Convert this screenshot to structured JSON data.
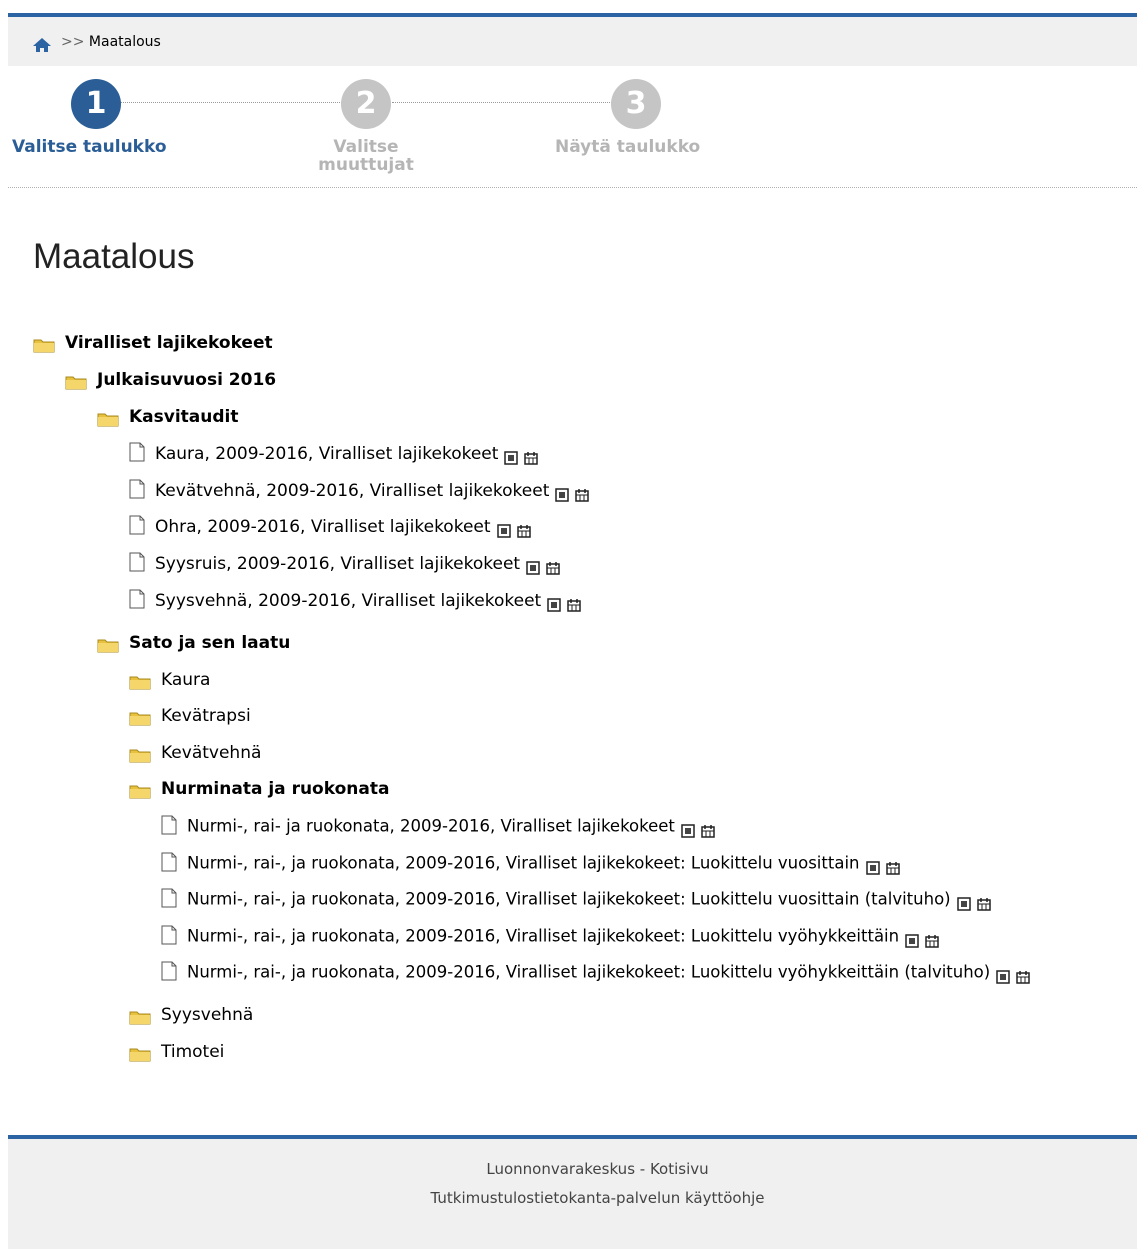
{
  "breadcrumb": {
    "separator": ">>",
    "current": "Maatalous"
  },
  "steps": [
    {
      "number": "1",
      "label": "Valitse taulukko"
    },
    {
      "number": "2",
      "label_line1": "Valitse",
      "label_line2": "muuttujat"
    },
    {
      "number": "3",
      "label": "Näytä taulukko"
    }
  ],
  "page_title": "Maatalous",
  "tree": {
    "l0": "Viralliset lajikekokeet",
    "l1": "Julkaisuvuosi 2016",
    "kasvitaudit": {
      "label": "Kasvitaudit",
      "files": [
        "Kaura, 2009-2016, Viralliset lajikekokeet",
        "Kevätvehnä, 2009-2016, Viralliset lajikekokeet",
        "Ohra, 2009-2016, Viralliset lajikekokeet",
        "Syysruis, 2009-2016, Viralliset lajikekokeet",
        "Syysvehnä, 2009-2016, Viralliset lajikekokeet"
      ]
    },
    "sato": {
      "label": "Sato ja sen laatu",
      "folders": [
        "Kaura",
        "Kevätrapsi",
        "Kevätvehnä"
      ],
      "nurminata": {
        "label": "Nurminata ja ruokonata",
        "files": [
          "Nurmi-, rai- ja ruokonata, 2009-2016, Viralliset lajikekokeet",
          "Nurmi-, rai-, ja ruokonata, 2009-2016, Viralliset lajikekokeet: Luokittelu vuosittain",
          "Nurmi-, rai-, ja ruokonata, 2009-2016, Viralliset lajikekokeet: Luokittelu vuosittain (talvituho)",
          "Nurmi-, rai-, ja ruokonata, 2009-2016, Viralliset lajikekokeet: Luokittelu vyöhykkeittäin",
          "Nurmi-, rai-, ja ruokonata, 2009-2016, Viralliset lajikekokeet: Luokittelu vyöhykkeittäin (talvituho)"
        ]
      },
      "folders_after": [
        "Syysvehnä",
        "Timotei"
      ]
    }
  },
  "footer": {
    "org_link": "Luonnonvarakeskus - Kotisivu",
    "help_link": "Tutkimustulostietokanta-palvelun käyttöohje"
  },
  "colors": {
    "accent": "#2b63a3",
    "step_active": "#2b5e96",
    "step_inactive": "#c5c5c5",
    "folder": "#e8c23f"
  },
  "icons": {
    "home": "home-icon",
    "folder": "folder-icon",
    "file": "file-icon",
    "table": "table-icon",
    "calendar": "calendar-icon"
  }
}
